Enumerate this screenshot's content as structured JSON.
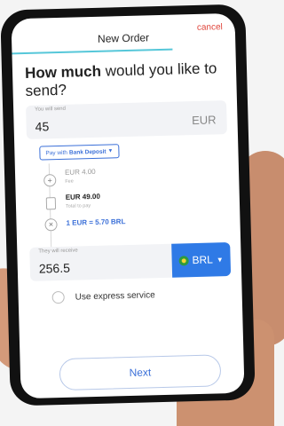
{
  "header": {
    "title": "New Order",
    "cancel_label": "cancel"
  },
  "question": {
    "bold": "How much",
    "rest": " would you like to send?"
  },
  "send": {
    "label": "You will send",
    "value": "45",
    "currency": "EUR"
  },
  "payment": {
    "prefix": "Pay with ",
    "method": "Bank Deposit"
  },
  "breakdown": {
    "fee_amount": "EUR 4.00",
    "fee_label": "Fee",
    "total_amount": "EUR 49.00",
    "total_label": "Total to pay",
    "rate": "1 EUR = 5.70 BRL"
  },
  "receive": {
    "label": "They will receive",
    "value": "256.5",
    "currency": "BRL"
  },
  "express": {
    "label": "Use express service",
    "checked": false
  },
  "footer": {
    "next_label": "Next"
  },
  "icons": {
    "fee": "plus-circle-icon",
    "total": "calculator-icon",
    "rate": "multiply-circle-icon",
    "flag": "brazil-flag-icon",
    "dropdown": "caret-down-icon"
  },
  "colors": {
    "accent": "#2f7ae6",
    "link": "#3a6fd8",
    "cancel": "#e0463c",
    "progress": "#56c7d9"
  }
}
